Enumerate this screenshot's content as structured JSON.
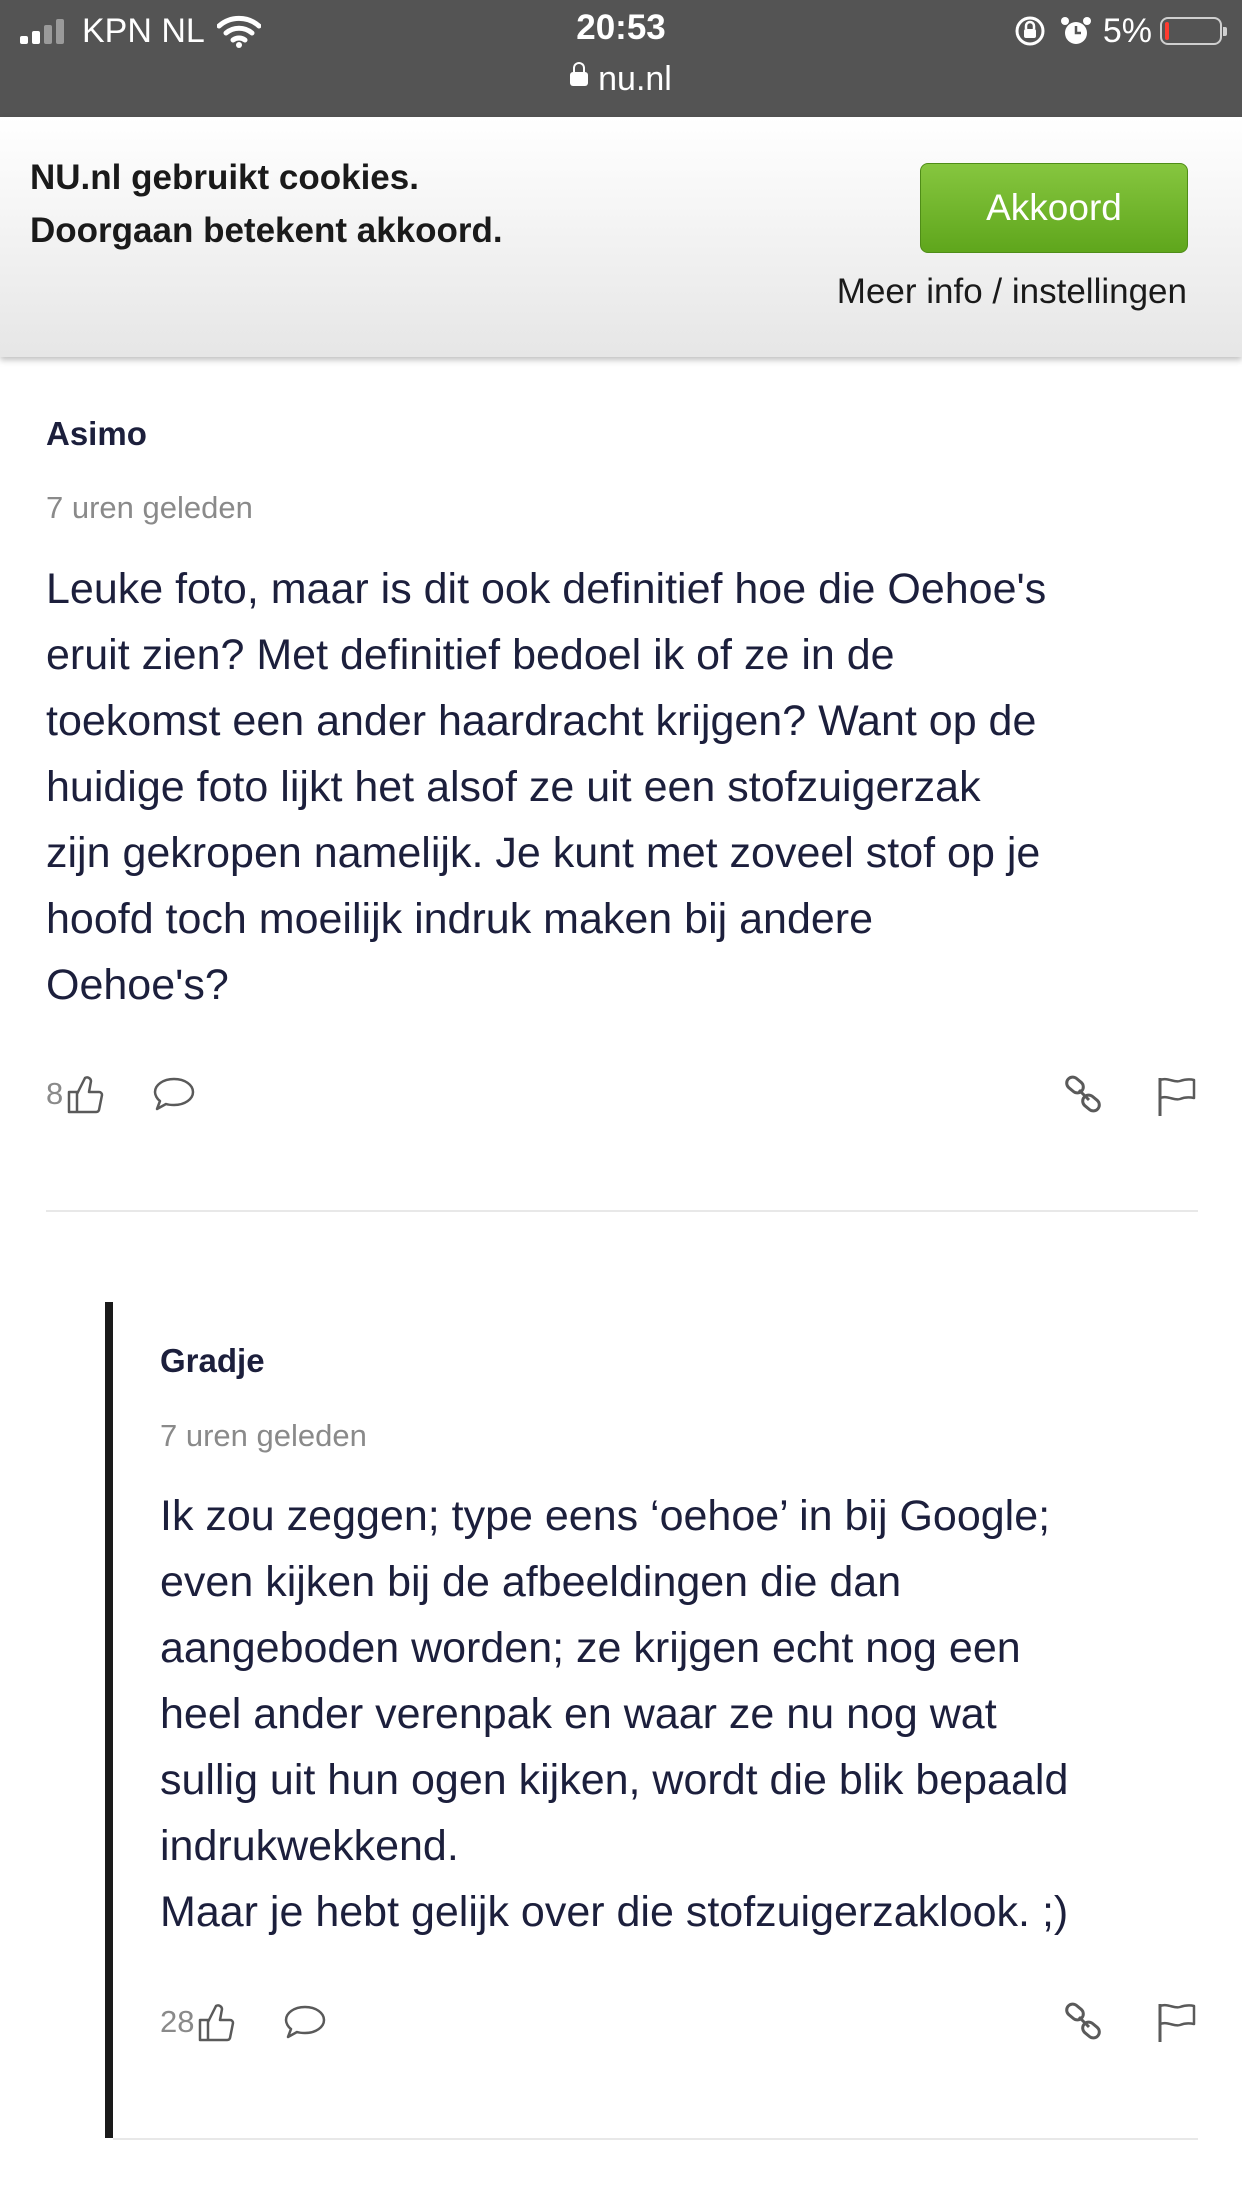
{
  "status_bar": {
    "carrier": "KPN NL",
    "time": "20:53",
    "url": "nu.nl",
    "battery_percent": "5%",
    "battery_level": 0.05
  },
  "cookie_banner": {
    "line1": "NU.nl gebruikt cookies.",
    "line2": "Doorgaan betekent akkoord.",
    "accept_label": "Akkoord",
    "more_info_label": "Meer info / instellingen",
    "accept_color": "#6cb42a"
  },
  "comments": [
    {
      "author": "Asimo",
      "time": "7 uren geleden",
      "lines": [
        "Leuke foto, maar is dit ook definitief hoe die Oehoe's",
        "eruit zien? Met definitief bedoel ik of ze in de",
        "toekomst een ander haardracht krijgen? Want op de",
        "huidige foto lijkt het alsof ze uit een stofzuigerzak",
        "zijn gekropen namelijk. Je kunt met zoveel stof op je",
        "hoofd toch moeilijk indruk maken bij andere",
        "Oehoe's?"
      ],
      "likes": "8"
    },
    {
      "author": "Gradje",
      "time": "7 uren geleden",
      "lines": [
        "Ik zou zeggen; type eens ‘oehoe’ in bij Google;",
        "even kijken bij de afbeeldingen die dan",
        "aangeboden worden; ze krijgen echt nog een",
        "heel ander verenpak en waar ze nu nog wat",
        "sullig uit hun ogen kijken, wordt die blik bepaald",
        "indrukwekkend.",
        "Maar je hebt gelijk over die stofzuigerzaklook. ;)"
      ],
      "likes": "28"
    }
  ],
  "icons": [
    "thumbs-up-icon",
    "comment-icon",
    "link-icon",
    "flag-icon"
  ]
}
